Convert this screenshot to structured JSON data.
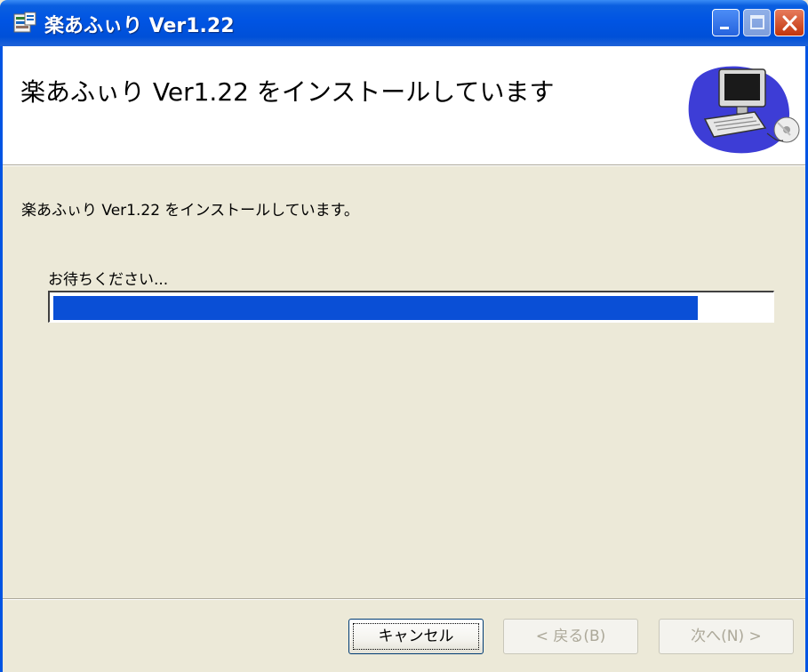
{
  "window": {
    "title": "楽あふぃり Ver1.22"
  },
  "header": {
    "title": "楽あふぃり Ver1.22 をインストールしています"
  },
  "body": {
    "status": "楽あふぃり Ver1.22 をインストールしています。",
    "wait": "お待ちください...",
    "progress_fraction": 0.9
  },
  "buttons": {
    "cancel": "キャンセル",
    "back": "< 戻る(B)",
    "next": "次へ(N) >"
  },
  "colors": {
    "titlebar": "#0054E3",
    "progress": "#0A4FD6",
    "background": "#ECE9D8"
  }
}
